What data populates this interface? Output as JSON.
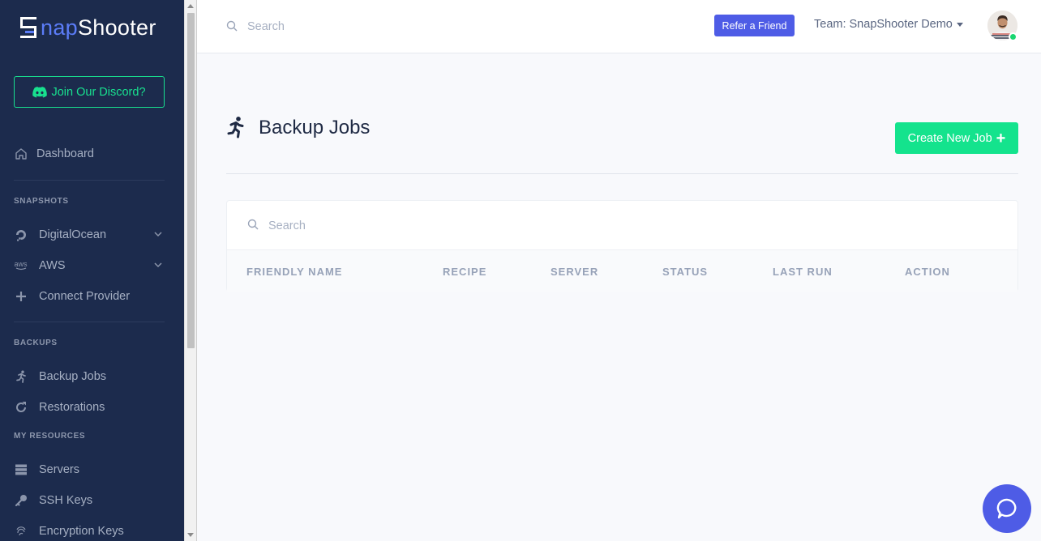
{
  "app": {
    "logo_text_prefix": "S",
    "logo_text_mid": "nap",
    "logo_text_suffix": "Shooter"
  },
  "sidebar": {
    "discord_label": "Join Our Discord?",
    "dashboard_label": "Dashboard",
    "sections": {
      "snapshots": "SNAPSHOTS",
      "backups": "BACKUPS",
      "resources": "MY RESOURCES"
    },
    "items": {
      "digitalocean": "DigitalOcean",
      "aws": "AWS",
      "connect_provider": "Connect Provider",
      "backup_jobs": "Backup Jobs",
      "restorations": "Restorations",
      "servers": "Servers",
      "ssh_keys": "SSH Keys",
      "encryption_keys": "Encryption Keys"
    },
    "aws_icon_text": "aws"
  },
  "topbar": {
    "search_placeholder": "Search",
    "refer_label": "Refer a Friend",
    "team_label": "Team: SnapShooter Demo"
  },
  "main": {
    "title": "Backup Jobs",
    "create_label": "Create New Job",
    "create_plus": "+",
    "table_search_placeholder": "Search",
    "columns": [
      "FRIENDLY NAME",
      "RECIPE",
      "SERVER",
      "STATUS",
      "LAST RUN",
      "ACTION"
    ],
    "rows": []
  },
  "colors": {
    "sidebar_bg": "#1c2b4d",
    "accent_green": "#14e38d",
    "accent_blue": "#4e5ce6"
  }
}
